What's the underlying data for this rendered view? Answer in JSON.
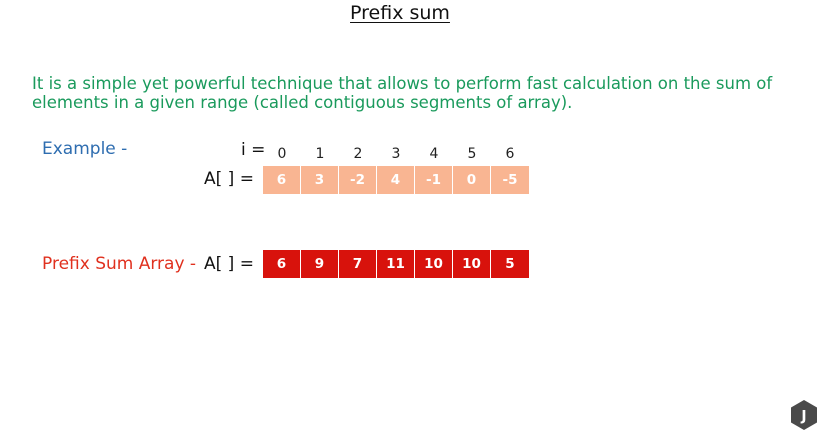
{
  "title": "Prefix sum",
  "intro": "It is a simple yet powerful technique that allows to perform fast calculation on the sum of elements in a given range (called contiguous segments of array).",
  "example": {
    "label": "Example -",
    "index_label": "i =",
    "array_label": "A[ ] =",
    "indices": [
      "0",
      "1",
      "2",
      "3",
      "4",
      "5",
      "6"
    ],
    "values": [
      "6",
      "3",
      "-2",
      "4",
      "-1",
      "0",
      "-5"
    ]
  },
  "prefix": {
    "label": "Prefix Sum Array -",
    "array_label": "A[ ] =",
    "values": [
      "6",
      "9",
      "7",
      "11",
      "10",
      "10",
      "5"
    ]
  },
  "logo": {
    "letter": "J"
  },
  "colors": {
    "intro": "#1a9a5c",
    "example_label": "#2e6db0",
    "prefix_label": "#e0301e",
    "example_cells": "#f9b592",
    "prefix_cells": "#d8120c"
  }
}
